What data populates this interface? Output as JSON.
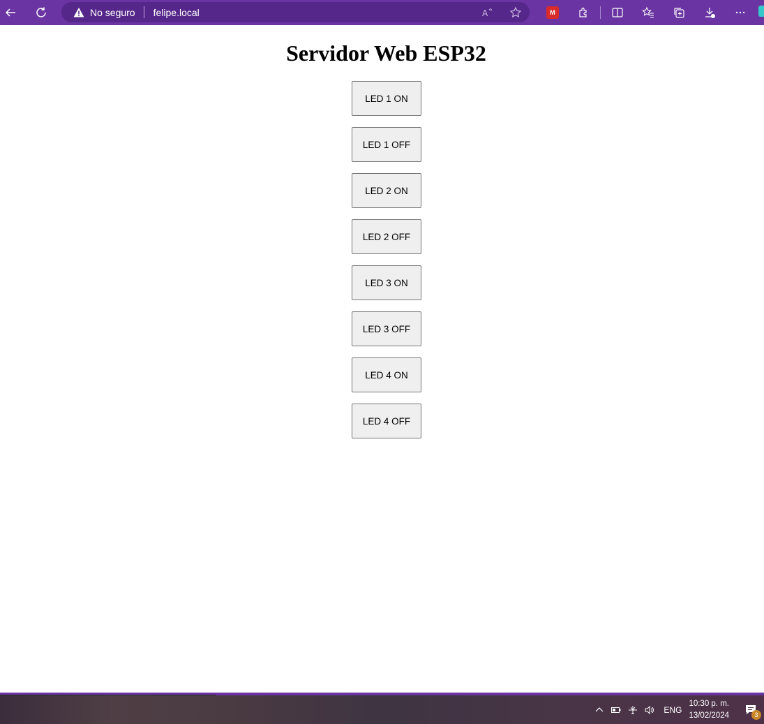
{
  "browser": {
    "security_label": "No seguro",
    "url": "felipe.local",
    "accent_color": "#6a35a3",
    "icons": [
      "back-icon",
      "refresh-icon",
      "warning-icon",
      "read-aloud-icon",
      "favorite-star-icon",
      "extension-mega-icon",
      "extensions-icon",
      "split-screen-icon",
      "favorites-icon",
      "collections-icon",
      "downloads-icon",
      "more-icon"
    ]
  },
  "page": {
    "title": "Servidor Web ESP32",
    "buttons": [
      {
        "label": "LED 1 ON"
      },
      {
        "label": "LED 1 OFF"
      },
      {
        "label": "LED 2 ON"
      },
      {
        "label": "LED 2 OFF"
      },
      {
        "label": "LED 3 ON"
      },
      {
        "label": "LED 3 OFF"
      },
      {
        "label": "LED 4 ON"
      },
      {
        "label": "LED 4 OFF"
      }
    ]
  },
  "taskbar": {
    "language": "ENG",
    "time": "10:30 p. m.",
    "date": "13/02/2024",
    "notification_count": "3"
  }
}
